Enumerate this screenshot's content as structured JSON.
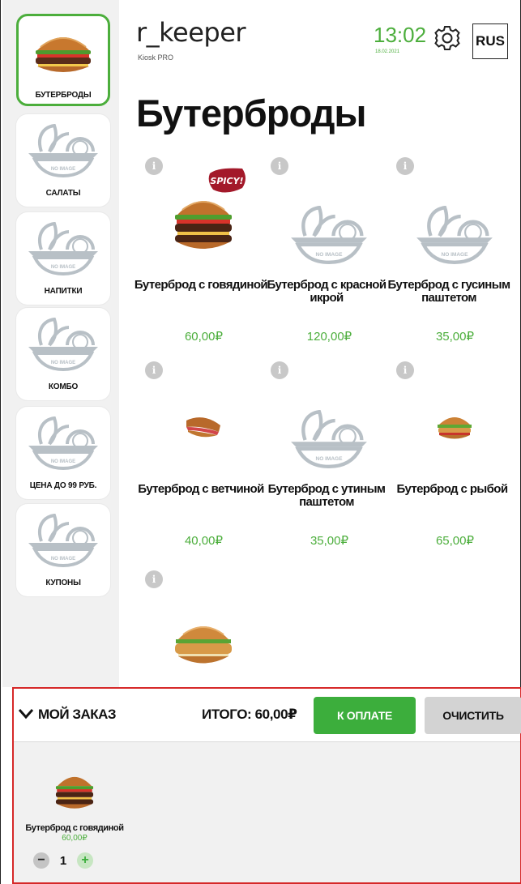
{
  "app": {
    "brand": "r_keeper",
    "brand_sub": "Kiosk PRO",
    "clock": "13:02",
    "date": "18.02.2021",
    "language": "RUS"
  },
  "categories": [
    {
      "label": "БУТЕРБРОДЫ",
      "image": "burger-photo",
      "active": true
    },
    {
      "label": "САЛАТЫ",
      "image": "no-image-placeholder",
      "active": false
    },
    {
      "label": "НАПИТКИ",
      "image": "no-image-placeholder",
      "active": false
    },
    {
      "label": "КОМБО",
      "image": "no-image-placeholder",
      "active": false
    },
    {
      "label": "ЦЕНА ДО 99 РУБ.",
      "image": "no-image-placeholder",
      "active": false
    },
    {
      "label": "КУПОНЫ",
      "image": "no-image-placeholder",
      "active": false
    }
  ],
  "page_title": "Бутерброды",
  "placeholder_text": "NO IMAGE",
  "spicy_badge": "SPICY!",
  "info_glyph": "i",
  "products": [
    {
      "name": "Бутерброд с говядиной",
      "price": "60,00₽",
      "image": "beef-burger-photo",
      "badge": "SPICY!"
    },
    {
      "name": "Бутерброд с красной икрой",
      "price": "120,00₽",
      "image": "no-image-placeholder"
    },
    {
      "name": "Бутерброд с гусиным паштетом",
      "price": "35,00₽",
      "image": "no-image-placeholder"
    },
    {
      "name": "Бутерброд с ветчиной",
      "price": "40,00₽",
      "image": "ham-sandwich-photo"
    },
    {
      "name": "Бутерброд с утиным паштетом",
      "price": "35,00₽",
      "image": "no-image-placeholder"
    },
    {
      "name": "Бутерброд с рыбой",
      "price": "65,00₽",
      "image": "fish-burger-photo"
    },
    {
      "name": "",
      "price": "",
      "image": "chicken-burger-photo"
    }
  ],
  "order": {
    "title": "МОЙ ЗАКАЗ",
    "total": "ИТОГО: 60,00₽",
    "pay_label": "К ОПЛАТЕ",
    "clear_label": "ОЧИСТИТЬ",
    "items": [
      {
        "name": "Бутерброд с говядиной",
        "price": "60,00₽",
        "quantity": "1"
      }
    ]
  },
  "colors": {
    "accent": "#4cae3c",
    "order_border": "#d62828",
    "sidebar_bg": "#f1f1f1"
  }
}
